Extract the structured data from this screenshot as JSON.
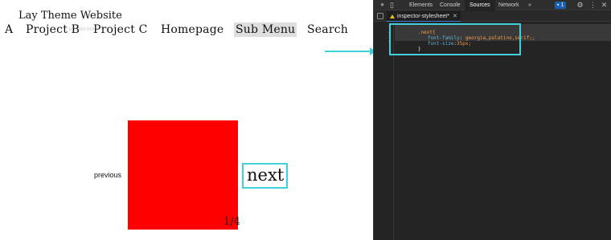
{
  "site": {
    "title": "Lay Theme Website",
    "nav": [
      "A",
      "Project B",
      "Project C",
      "Homepage",
      "Sub Menu",
      "Search"
    ],
    "active_nav": "Sub Menu",
    "slider": {
      "previous": "previous",
      "next": "next",
      "counter": "1/4",
      "image_color": "#ff0000"
    }
  },
  "annotation": {
    "color": "#3fd0dc"
  },
  "devtools": {
    "tabs": [
      "Elements",
      "Console",
      "Sources",
      "Network"
    ],
    "active_tab": "Sources",
    "more_tabs": "»",
    "issues_count": "1",
    "file_tab": "inspector-stylesheet*",
    "line_numbers": [
      "1",
      "2",
      "3",
      "4"
    ],
    "code": {
      "line1": ".next{",
      "line2_prop": "font-family",
      "line2_val": "georgia,palatino,serif;;",
      "line3_prop": "font-size",
      "line3_val": "35px;",
      "line4": "}"
    }
  }
}
